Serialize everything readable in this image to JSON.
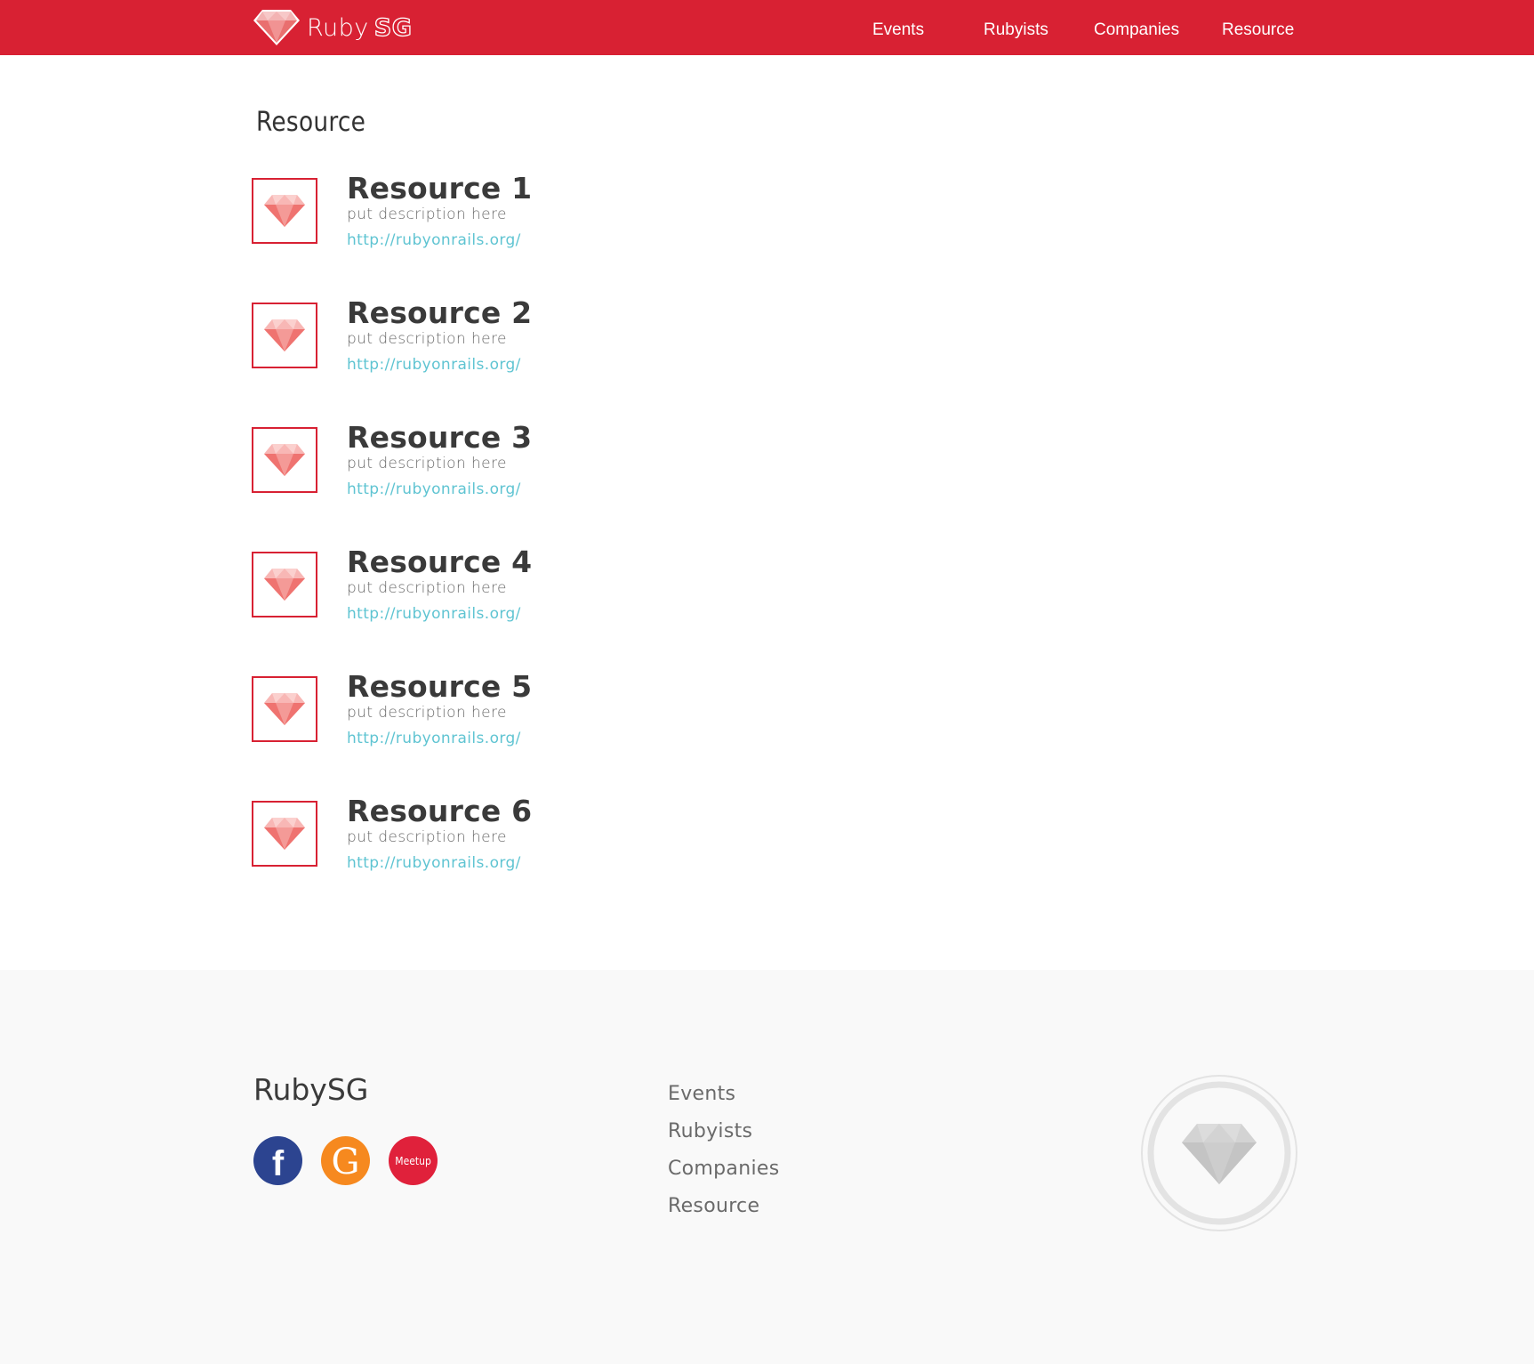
{
  "header": {
    "brand": {
      "word": "Ruby",
      "accent": "SG",
      "icon": "ruby-gem-icon"
    },
    "nav": [
      {
        "label": "Events"
      },
      {
        "label": "Rubyists"
      },
      {
        "label": "Companies"
      },
      {
        "label": "Resource"
      }
    ]
  },
  "main": {
    "title": "Resource",
    "resources": [
      {
        "title": "Resource 1",
        "description": "put description here",
        "url": "http://rubyonrails.org/"
      },
      {
        "title": "Resource 2",
        "description": "put description here",
        "url": "http://rubyonrails.org/"
      },
      {
        "title": "Resource 3",
        "description": "put description here",
        "url": "http://rubyonrails.org/"
      },
      {
        "title": "Resource 4",
        "description": "put description here",
        "url": "http://rubyonrails.org/"
      },
      {
        "title": "Resource 5",
        "description": "put description here",
        "url": "http://rubyonrails.org/"
      },
      {
        "title": "Resource 6",
        "description": "put description here",
        "url": "http://rubyonrails.org/"
      }
    ]
  },
  "footer": {
    "brand": "RubySG",
    "social": [
      {
        "name": "facebook",
        "icon": "facebook-icon",
        "glyph": "f"
      },
      {
        "name": "google",
        "icon": "google-icon",
        "glyph": "G"
      },
      {
        "name": "meetup",
        "icon": "meetup-icon",
        "glyph": "Meetup"
      }
    ],
    "nav": [
      {
        "label": "Events"
      },
      {
        "label": "Rubyists"
      },
      {
        "label": "Companies"
      },
      {
        "label": "Resource"
      }
    ],
    "emblem_icon": "ruby-gem-emblem-icon"
  },
  "colors": {
    "brand_red": "#d82133",
    "link_cyan": "#5fc4d2",
    "footer_bg": "#f9f9f9",
    "facebook_blue": "#2c4490",
    "google_orange": "#f6891f",
    "meetup_red": "#e0213b"
  }
}
